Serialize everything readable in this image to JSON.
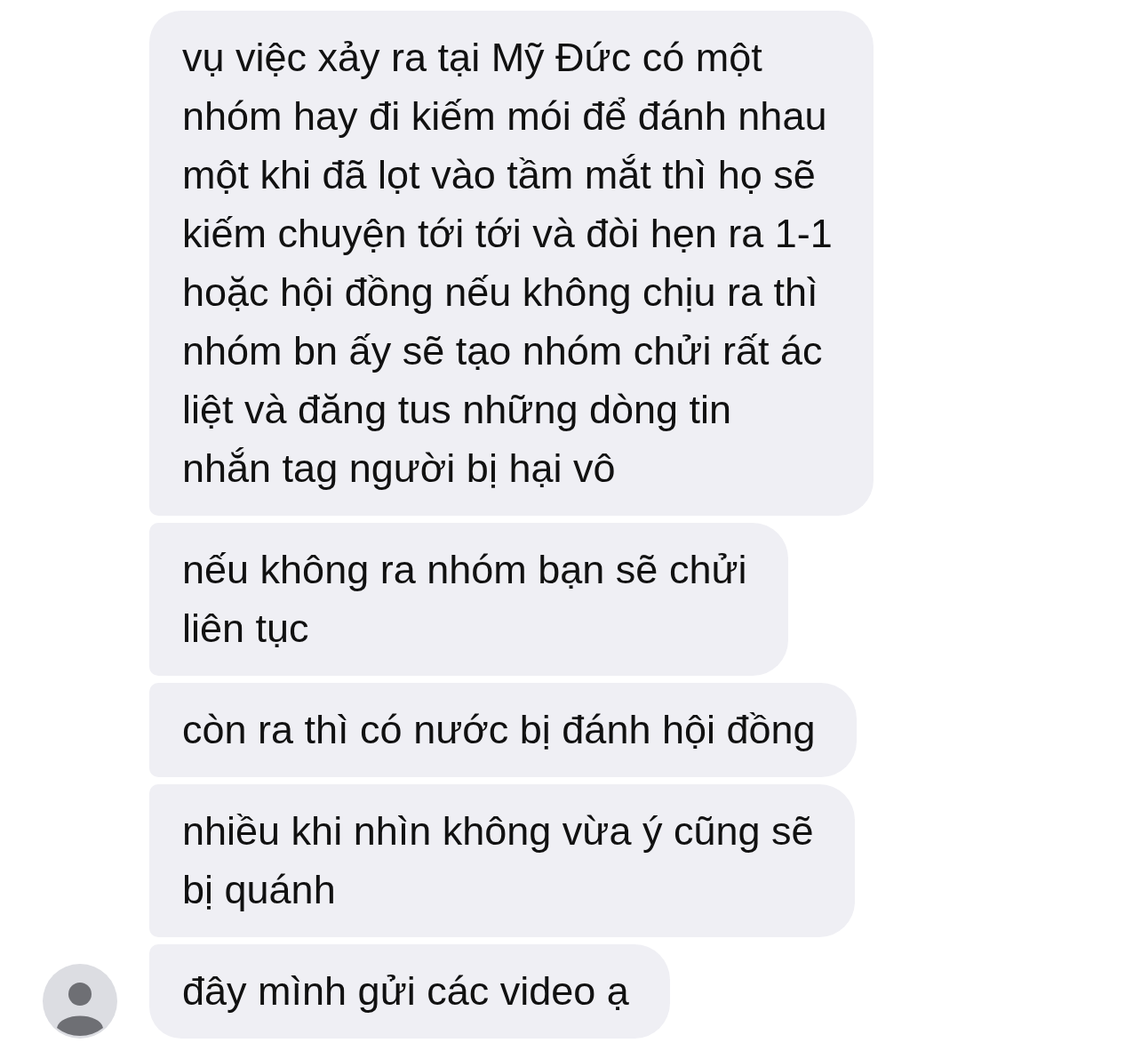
{
  "messages": [
    {
      "text": "vụ việc xảy ra tại Mỹ Đức có một\nnhóm hay đi kiếm mói để đánh nhau\nmột khi đã lọt vào tầm mắt thì họ sẽ\nkiếm chuyện tới tới và đòi hẹn ra 1-1\nhoặc hội đồng nếu không chịu ra thì\nnhóm bn ấy sẽ tạo nhóm chửi rất ác\nliệt và đăng tus những dòng tin\nnhắn tag người bị hại vô"
    },
    {
      "text": "nếu không ra nhóm bạn sẽ chửi\nliên tục"
    },
    {
      "text": "còn ra thì có nước bị đánh hội đồng"
    },
    {
      "text": "nhiều khi nhìn không vừa ý cũng sẽ\nbị quánh"
    },
    {
      "text": "đây mình gửi các video ạ"
    }
  ]
}
